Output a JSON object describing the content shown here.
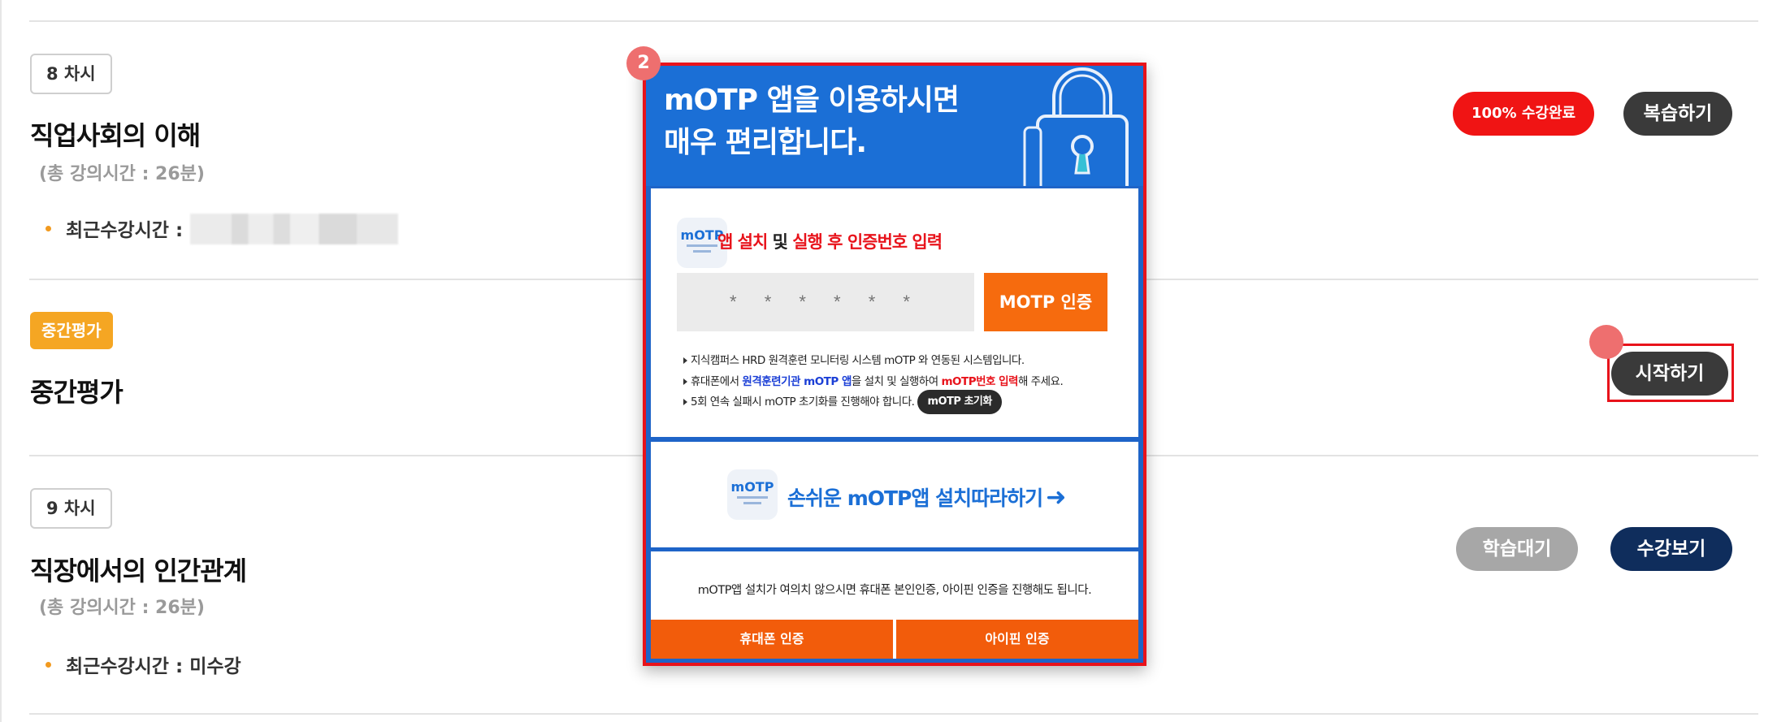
{
  "lectures": [
    {
      "tag": "8 차시",
      "title": "직업사회의 이해",
      "subtitle": "(총 강의시간 : 26분)",
      "recent_label": "최근수강시간 :",
      "recent_value": "",
      "status_badge": "100% 수강완료",
      "action_label": "복습하기"
    },
    {
      "tag": "중간평가",
      "title": "중간평가",
      "action_label": "시작하기"
    },
    {
      "tag": "9 차시",
      "title": "직장에서의 인간관계",
      "subtitle": "(총 강의시간 : 26분)",
      "recent_label": "최근수강시간 :",
      "recent_value": "미수강",
      "wait_label": "학습대기",
      "action_label": "수강보기"
    }
  ],
  "step_markers": [
    "2"
  ],
  "modal": {
    "title_line1": "mOTP 앱을 이용하시면",
    "title_line2": "매우 편리합니다.",
    "app_icon_text": "mOTP",
    "install": {
      "part1": "앱 설치",
      "part2": "및",
      "part3": "실행 후 인증번호 입력"
    },
    "otp_placeholder": "* * * * * *",
    "otp_button": "MOTP 인증",
    "notes": {
      "n1": "지식캠퍼스 HRD 원격훈련 모니터링 시스템 mOTP 와 연동된 시스템입니다.",
      "n2_a": "휴대폰에서",
      "n2_b": "원격훈련기관 mOTP 앱",
      "n2_c": "을 설치 및 실행하여",
      "n2_d": "mOTP번호 입력",
      "n2_e": "해 주세요.",
      "n3": "5회 연속 실패시 mOTP 초기화를 진행해야 합니다.",
      "reset_button": "mOTP 초기화"
    },
    "guide_link": "손쉬운 mOTP앱 설치따라하기",
    "alt_text": "mOTP앱 설치가 여의치 않으시면 휴대폰 본인인증, 아이핀 인증을 진행해도 됩니다.",
    "phone_auth": "휴대폰 인증",
    "ipin_auth": "아이핀 인증"
  },
  "colors": {
    "modal_blue": "#1b6fd6",
    "accent_orange": "#f66b0e",
    "complete_red": "#f01414",
    "highlight_red": "#e8131b",
    "navy": "#0f2d5c",
    "eval_orange": "#f5a623"
  }
}
